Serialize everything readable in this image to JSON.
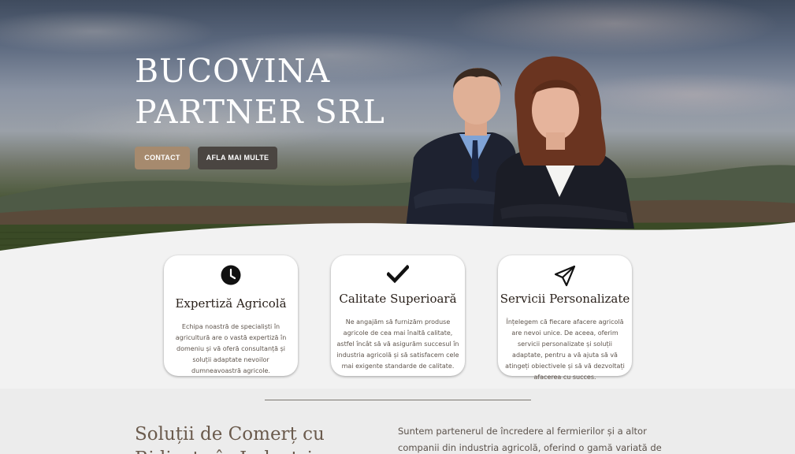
{
  "hero": {
    "title": "BUCOVINA PARTNER SRL",
    "buttons": {
      "contact": "CONTACT",
      "more": "AFLA MAI MULTE"
    }
  },
  "features": [
    {
      "icon": "clock-icon",
      "title": "Expertiză Agricolă",
      "text": "Echipa noastră de specialiști în agricultură are o vastă expertiză în domeniu și vă oferă consultanță și soluții adaptate nevoilor dumneavoastră agricole."
    },
    {
      "icon": "checkmark-icon",
      "title": "Calitate Superioară",
      "text": "Ne angajăm să furnizăm produse agricole de cea mai înaltă calitate, astfel încât să vă asigurăm succesul în industria agricolă și să satisfacem cele mai exigente standarde de calitate."
    },
    {
      "icon": "paper-plane-icon",
      "title": "Servicii Personalizate",
      "text": "Înțelegem că fiecare afacere agricolă are nevoi unice. De aceea, oferim servicii personalizate și soluții adaptate, pentru a vă ajuta să vă atingeți obiectivele și să vă dezvoltați afacerea cu succes."
    }
  ],
  "about": {
    "title": "Soluții de Comerț cu Ridicata în Industria",
    "text": "Suntem partenerul de încredere al fermierilor și a altor companii din industria agricolă, oferind o gamă variată de produse"
  }
}
